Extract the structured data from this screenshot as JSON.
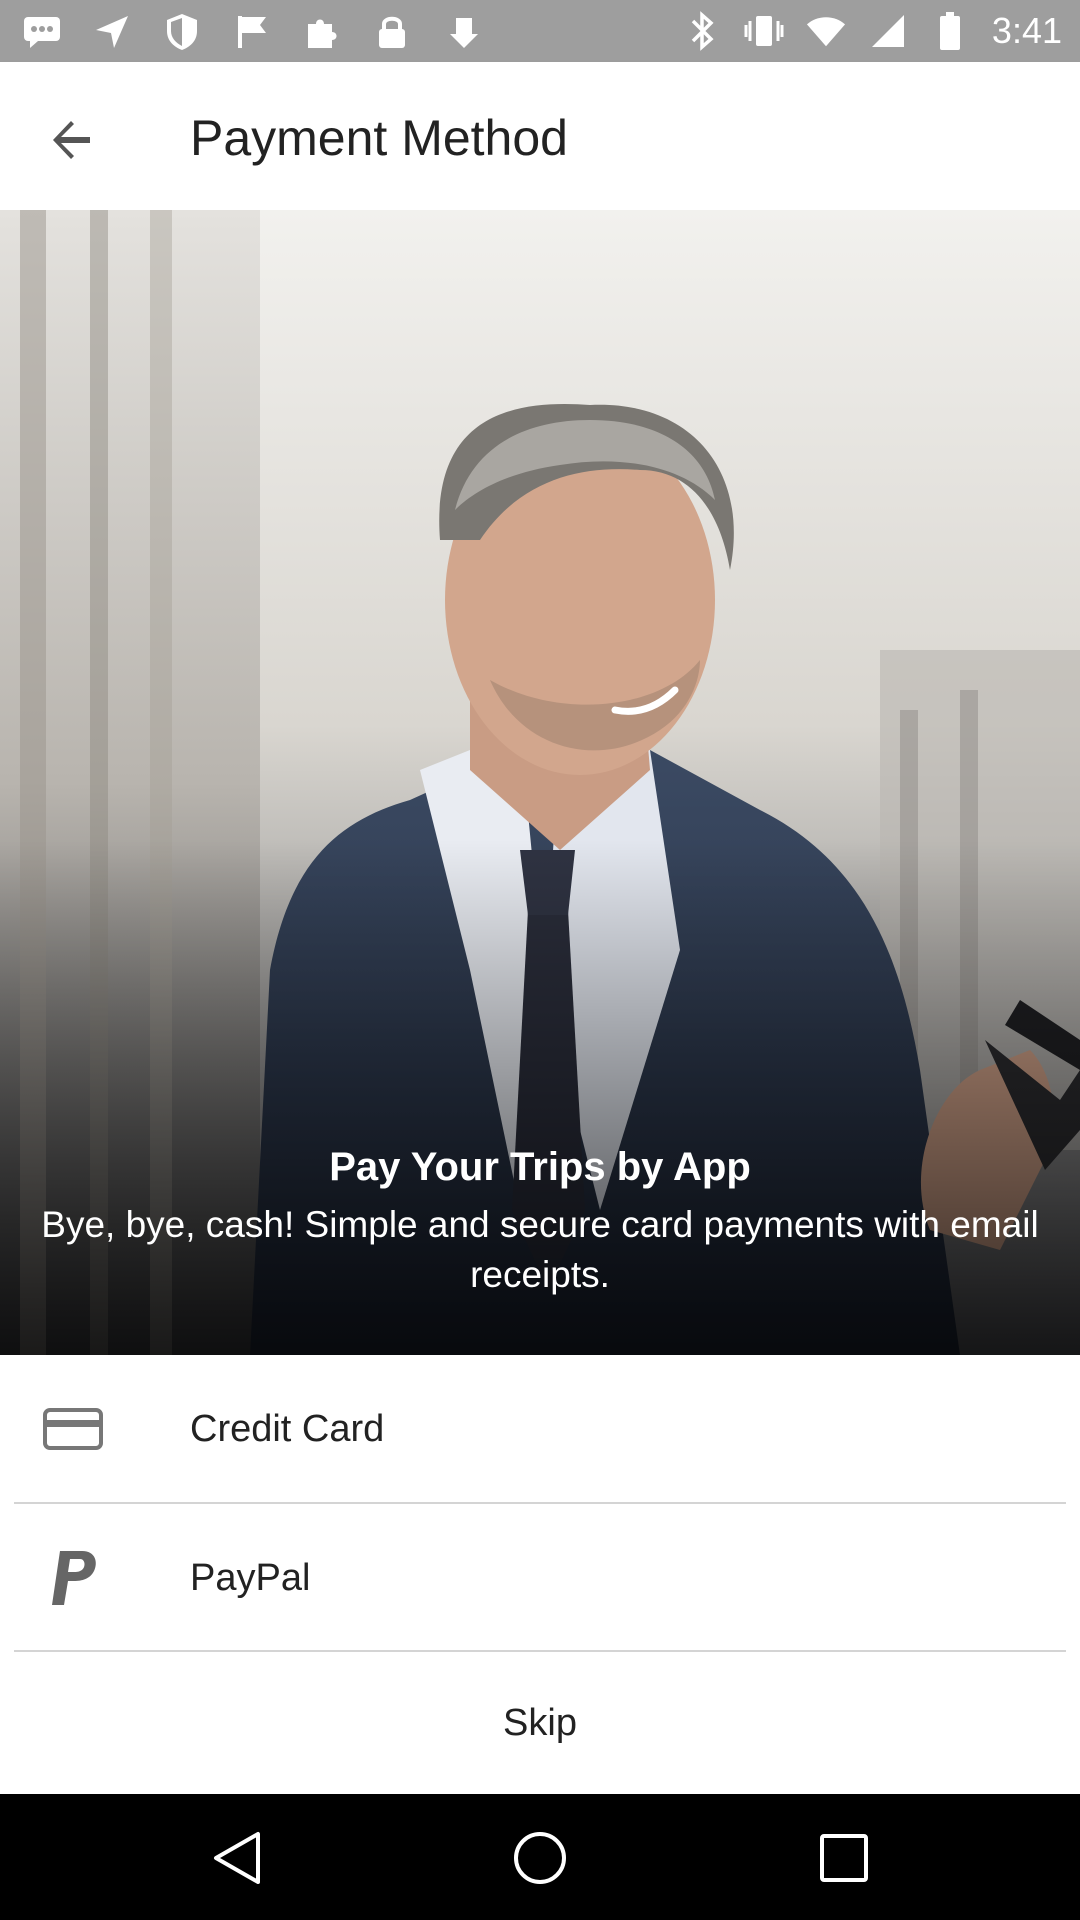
{
  "status_bar": {
    "time": "3:41",
    "left_icons": [
      "messages-icon",
      "navigation-icon",
      "shield-icon",
      "flag-icon",
      "puzzle-icon",
      "lock-icon",
      "download-icon"
    ],
    "right_icons": [
      "bluetooth-icon",
      "vibrate-icon",
      "wifi-icon",
      "signal-icon",
      "battery-icon"
    ]
  },
  "app_bar": {
    "title": "Payment Method"
  },
  "hero": {
    "title": "Pay Your Trips by App",
    "subtitle": "Bye, bye, cash! Simple and secure card payments with email receipts."
  },
  "options": [
    {
      "label": "Credit Card",
      "icon": "credit-card-icon"
    },
    {
      "label": "PayPal",
      "icon": "paypal-icon"
    }
  ],
  "skip_label": "Skip",
  "colors": {
    "status_bar": "#9e9e9e",
    "nav_bar": "#000000",
    "text": "#222222",
    "divider": "#d4d4d4"
  }
}
